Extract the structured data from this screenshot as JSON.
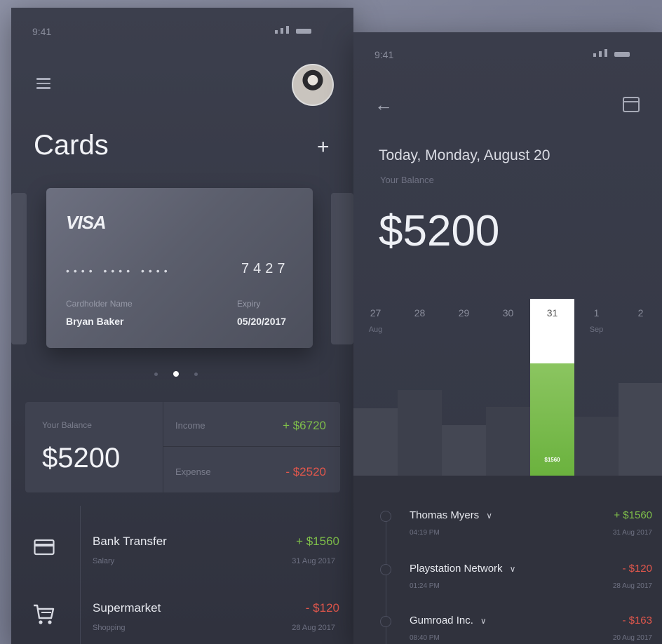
{
  "colors": {
    "positive": "#7fbf4a",
    "negative": "#e2574c",
    "accent_green": "#6bb23e"
  },
  "left": {
    "status_time": "9:41",
    "menu_icon": "hamburger-icon",
    "avatar_icon": "profile-avatar",
    "title": "Cards",
    "add_icon": "plus-icon",
    "card": {
      "brand": "VISA",
      "masked": "•••• •••• ••••",
      "last4": "7427",
      "holder_label": "Cardholder Name",
      "holder": "Bryan Baker",
      "expiry_label": "Expiry",
      "expiry": "05/20/2017"
    },
    "pager": {
      "count": 3,
      "active": 2
    },
    "balance": {
      "label": "Your Balance",
      "value": "$5200",
      "income_label": "Income",
      "income": "+ $6720",
      "expense_label": "Expense",
      "expense": "- $2520"
    },
    "transactions": [
      {
        "icon": "credit-card-icon",
        "name": "Bank Transfer",
        "category": "Salary",
        "amount": "+ $1560",
        "date": "31 Aug 2017"
      },
      {
        "icon": "shopping-cart-icon",
        "name": "Supermarket",
        "category": "Shopping",
        "amount": "- $120",
        "date": "28 Aug 2017"
      }
    ]
  },
  "right": {
    "status_time": "9:41",
    "back_icon": "arrow-left-icon",
    "calendar_icon": "calendar-icon",
    "date": "Today, Monday, August 20",
    "balance_label": "Your Balance",
    "balance": "$5200",
    "days": [
      {
        "day": "27",
        "month": "Aug",
        "level": 0.48
      },
      {
        "day": "28",
        "month": "",
        "level": 0.61
      },
      {
        "day": "29",
        "month": "",
        "level": 0.36
      },
      {
        "day": "30",
        "month": "",
        "level": 0.49
      },
      {
        "day": "31",
        "month": "",
        "level": 0.8,
        "selected": true,
        "amount": "$1560"
      },
      {
        "day": "1",
        "month": "Sep",
        "level": 0.42
      },
      {
        "day": "2",
        "month": "",
        "level": 0.66
      }
    ],
    "transactions": [
      {
        "name": "Thomas Myers",
        "time": "04:19 PM",
        "amount": "+ $1560",
        "date": "31 Aug 2017",
        "sign": "pos"
      },
      {
        "name": "Playstation Network",
        "time": "01:24 PM",
        "amount": "- $120",
        "date": "28 Aug 2017",
        "sign": "neg"
      },
      {
        "name": "Gumroad Inc.",
        "time": "08:40 PM",
        "amount": "- $163",
        "date": "20 Aug 2017",
        "sign": "neg"
      }
    ]
  }
}
